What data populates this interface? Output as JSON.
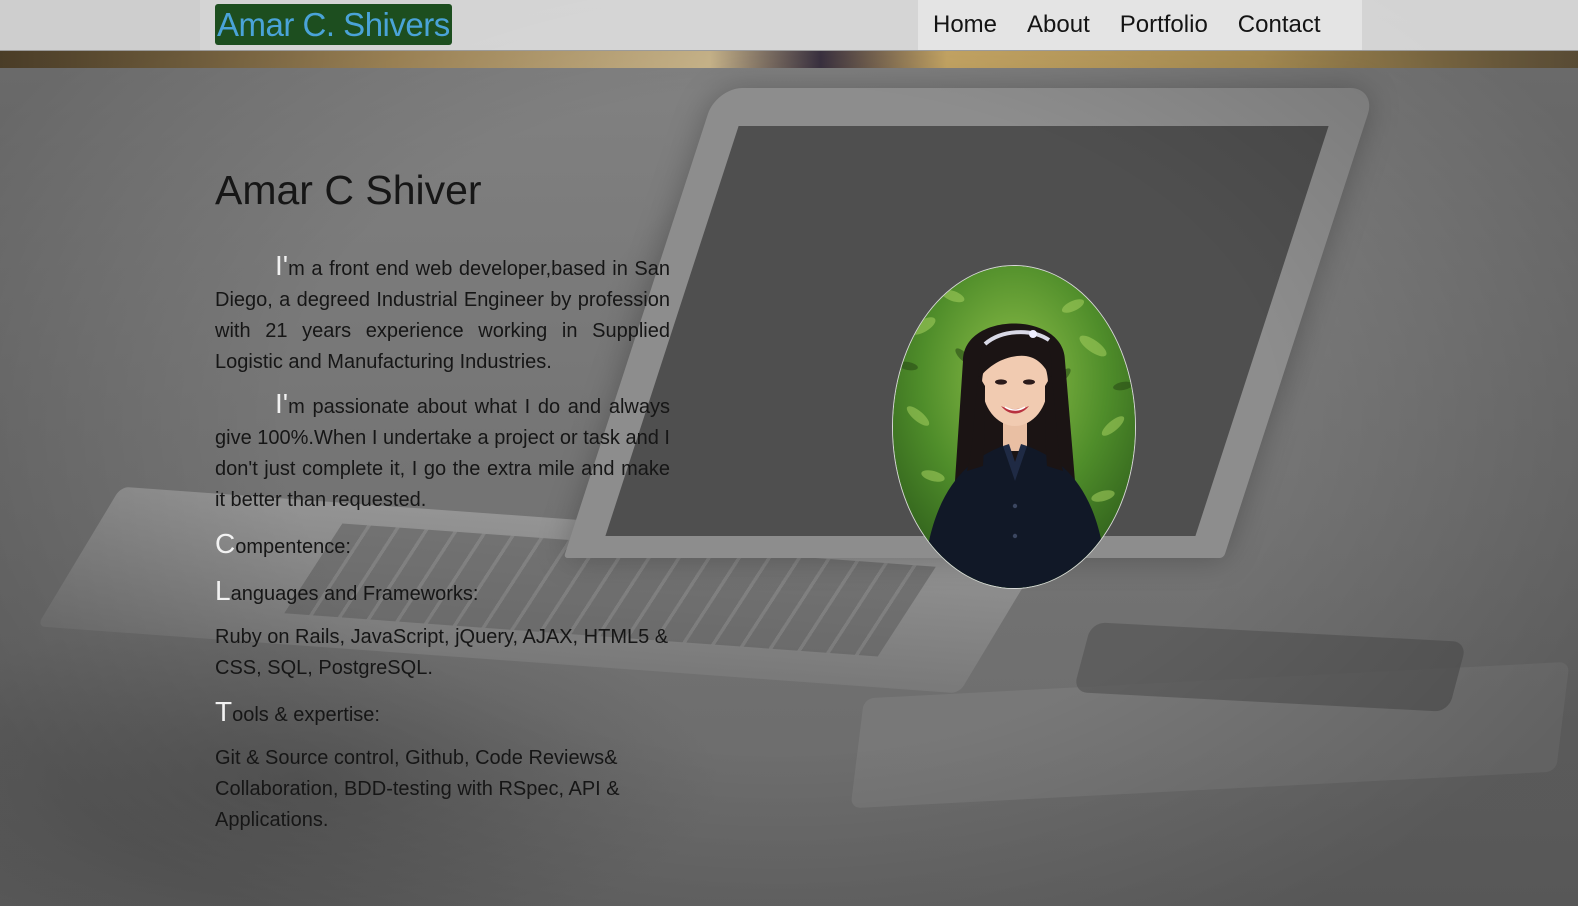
{
  "header": {
    "brand": "Amar C. Shivers",
    "nav": {
      "home": "Home",
      "about": "About",
      "portfolio": "Portfolio",
      "contact": "Contact"
    }
  },
  "about": {
    "title": "Amar C Shiver",
    "paragraph1": {
      "cap": "I'",
      "text": "m a front end web developer,based in San Diego, a degreed Industrial Engineer by profession with 21 years experience working in Supplied Logistic and Manufacturing Industries."
    },
    "paragraph2": {
      "cap": "I'",
      "text": "m passionate about what I do and always give 100%.When I undertake a project or task and I don't just complete it, I go the extra mile and make it better than requested."
    },
    "competence": {
      "cap": "C",
      "text": "ompentence:"
    },
    "languages": {
      "cap": "L",
      "text": "anguages and Frameworks:",
      "list": "Ruby on Rails, JavaScript, jQuery, AJAX, HTML5 & CSS, SQL, PostgreSQL."
    },
    "tools": {
      "cap": "T",
      "text": "ools & expertise:",
      "list": "Git & Source control, Github, Code Reviews& Collaboration, BDD-testing with RSpec, API & Applications."
    }
  },
  "theme": {
    "brand_background": "#1d4e1f",
    "brand_text": "#4aa3d8",
    "header_background": "#dcdcdc",
    "text": "#161616",
    "drop_cap": "#f2f2f2"
  }
}
